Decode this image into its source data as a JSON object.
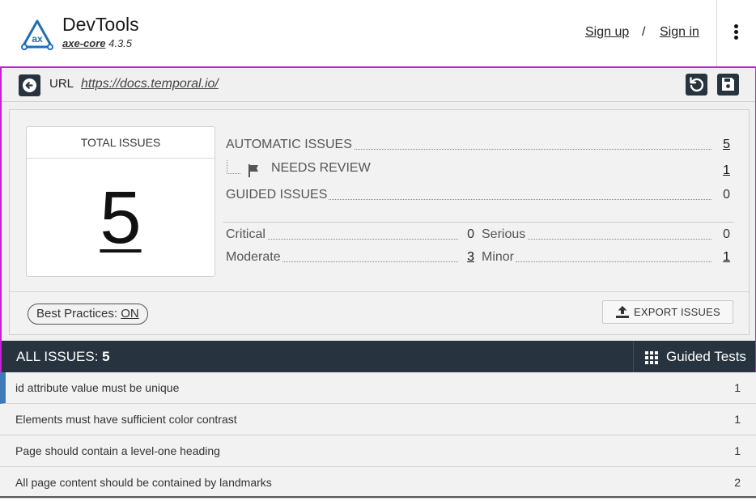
{
  "header": {
    "brand_name": "DevTools",
    "brand_sub_core": "axe-core",
    "brand_sub_version": "4.3.5",
    "logo_text": "ax",
    "signup": "Sign up",
    "slash": "/",
    "signin": "Sign in",
    "menu_icon": "kebab-menu-icon"
  },
  "url_bar": {
    "back_icon": "back-arrow-icon",
    "label": "URL",
    "url": "https://docs.temporal.io/",
    "rerun_icon": "rerun-icon",
    "save_icon": "save-icon"
  },
  "summary": {
    "total_label": "TOTAL ISSUES",
    "total_value": "5",
    "automatic_label": "AUTOMATIC ISSUES",
    "automatic_value": "5",
    "needs_review_label": "NEEDS REVIEW",
    "needs_review_value": "1",
    "guided_label": "GUIDED ISSUES",
    "guided_value": "0",
    "critical_label": "Critical",
    "critical_value": "0",
    "serious_label": "Serious",
    "serious_value": "0",
    "moderate_label": "Moderate",
    "moderate_value": "3",
    "minor_label": "Minor",
    "minor_value": "1",
    "best_practices_label": "Best Practices:",
    "best_practices_value": "ON",
    "export_label": "EXPORT ISSUES"
  },
  "issues_bar": {
    "all_issues_label": "ALL ISSUES:",
    "all_issues_value": "5",
    "guided_tests_label": "Guided Tests"
  },
  "issues": [
    {
      "title": "id attribute value must be unique",
      "count": "1"
    },
    {
      "title": "Elements must have sufficient color contrast",
      "count": "1"
    },
    {
      "title": "Page should contain a level-one heading",
      "count": "1"
    },
    {
      "title": "All page content should be contained by landmarks",
      "count": "2"
    }
  ],
  "colors": {
    "accent_border": "#c71fd6",
    "dark_bar": "#27343f",
    "active_indicator": "#3d7bb6",
    "logo_blue": "#1e6fb5"
  }
}
